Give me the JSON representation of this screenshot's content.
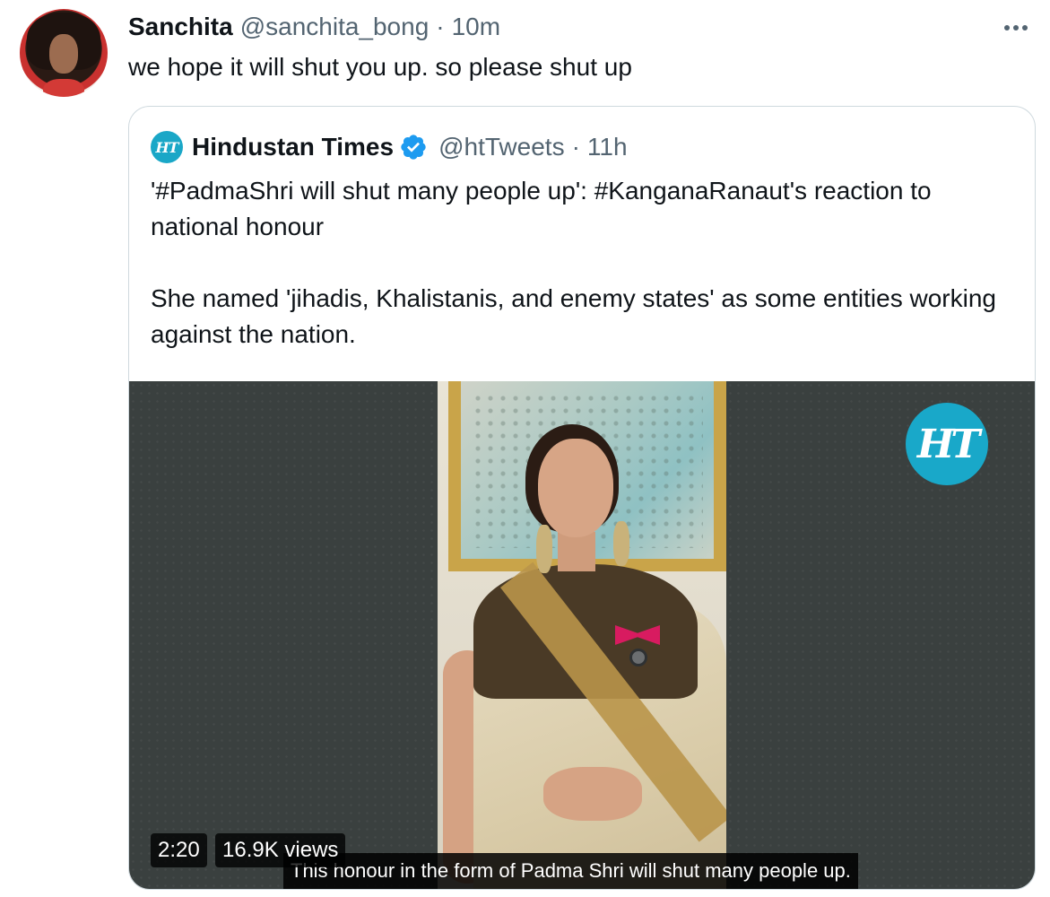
{
  "tweet": {
    "author_name": "Sanchita",
    "author_handle": "@sanchita_bong",
    "separator": "·",
    "time": "10m",
    "text": "we hope it will shut you up. so please shut up"
  },
  "quoted_tweet": {
    "logo_text": "HT",
    "author_name": "Hindustan Times",
    "author_handle": "@htTweets",
    "separator": "·",
    "time": "11h",
    "paragraph_1": "'#PadmaShri will shut many people up': #KanganaRanaut's reaction to national honour",
    "paragraph_2": "She named 'jihadis, Khalistanis, and enemy states' as some entities working against the nation.",
    "media": {
      "watermark": "HT",
      "duration": "2:20",
      "views": "16.9K views",
      "subtitle": "This honour in the form of Padma Shri will shut many people up."
    }
  },
  "colors": {
    "text_primary": "#0f1419",
    "text_secondary": "#536471",
    "verified_blue": "#1d9bf0",
    "ht_brand": "#19a8c9",
    "border": "#cfd9de"
  },
  "icons": {
    "more": "more-horizontal-icon",
    "verified": "verified-badge-icon"
  }
}
